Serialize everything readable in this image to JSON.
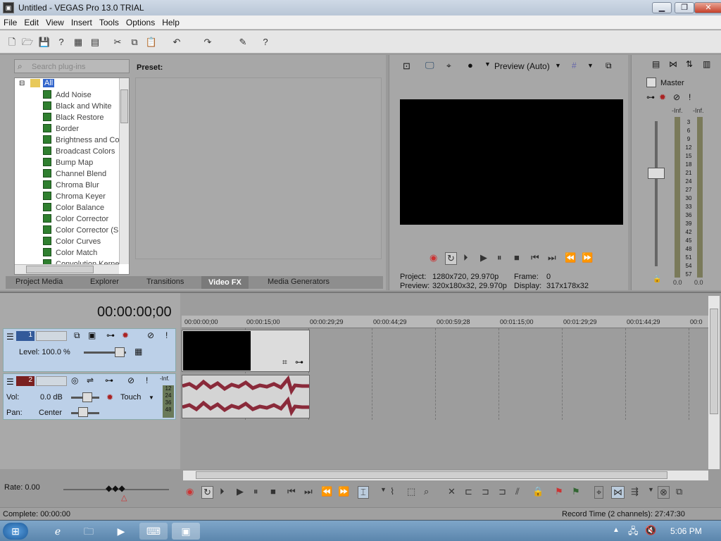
{
  "window": {
    "title": "Untitled - VEGAS Pro 13.0 TRIAL",
    "app_icon": "▣"
  },
  "window_controls": {
    "min": "▁",
    "max": "❐",
    "close": "✕"
  },
  "menu": [
    "File",
    "Edit",
    "View",
    "Insert",
    "Tools",
    "Options",
    "Help"
  ],
  "toolbar_icons": [
    "new-icon",
    "open-icon",
    "save-icon",
    "save-as-icon",
    "render-icon",
    "properties-icon",
    "cut-icon",
    "copy-icon",
    "paste-icon",
    "undo-icon",
    "redo-icon",
    "edit-tool-icon",
    "help-icon"
  ],
  "fx_panel": {
    "search_placeholder": "Search plug-ins",
    "preset_label": "Preset:",
    "root": "All",
    "items": [
      "Add Noise",
      "Black and White",
      "Black Restore",
      "Border",
      "Brightness and Co",
      "Broadcast Colors",
      "Bump Map",
      "Channel Blend",
      "Chroma Blur",
      "Chroma Keyer",
      "Color Balance",
      "Color Corrector",
      "Color Corrector (S",
      "Color Curves",
      "Color Match",
      "Convolution Kerne"
    ],
    "tabs": [
      "Project Media",
      "Explorer",
      "Transitions",
      "Video FX",
      "Media Generators"
    ],
    "active_tab": "Video FX"
  },
  "preview": {
    "mode": "Preview (Auto)",
    "project_label": "Project:",
    "project_value": "1280x720, 29.970p",
    "preview_label": "Preview:",
    "preview_value": "320x180x32, 29.970p",
    "frame_label": "Frame:",
    "frame_value": "0",
    "display_label": "Display:",
    "display_value": "317x178x32"
  },
  "master": {
    "label": "Master",
    "left_peak": "-Inf.",
    "right_peak": "-Inf.",
    "scale": [
      "3",
      "6",
      "9",
      "12",
      "15",
      "18",
      "21",
      "24",
      "27",
      "30",
      "33",
      "36",
      "39",
      "42",
      "45",
      "48",
      "51",
      "54",
      "57"
    ],
    "left_bottom": "0.0",
    "right_bottom": "0.0"
  },
  "timeline": {
    "timecode": "00:00:00;00",
    "ruler": [
      "00:00:00;00",
      "00:00:15;00",
      "00:00:29;29",
      "00:00:44;29",
      "00:00:59;28",
      "00:01:15;00",
      "00:01:29;29",
      "00:01:44;29",
      "00:0"
    ],
    "video_track": {
      "number": "1",
      "level_label": "Level: 100.0 %"
    },
    "audio_track": {
      "number": "2",
      "vol_label": "Vol:",
      "vol_value": "0.0 dB",
      "pan_label": "Pan:",
      "pan_value": "Center",
      "mode": "Touch",
      "peak": "-Inf.",
      "meter_scale": [
        "12",
        "24",
        "36",
        "48"
      ]
    }
  },
  "rate_label": "Rate: 0.00",
  "status": {
    "left": "Complete: 00:00:00",
    "right": "Record Time (2 channels): 27:47:30"
  },
  "taskbar": {
    "time": "5:06 PM"
  }
}
